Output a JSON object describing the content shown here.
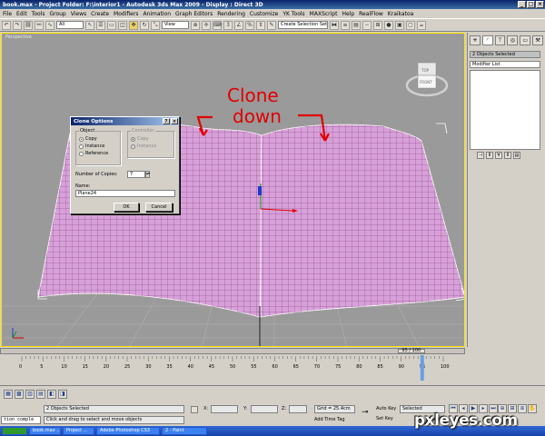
{
  "window": {
    "title": "book.max   - Project Folder: F:\\interior1      - Autodesk 3ds Max  2009        - Display : Direct 3D"
  },
  "menu": [
    "File",
    "Edit",
    "Tools",
    "Group",
    "Views",
    "Create",
    "Modifiers",
    "Animation",
    "Graph Editors",
    "Rendering",
    "Customize",
    "YK Tools",
    "MAXScript",
    "Help",
    "RealFlow",
    "Kraikatoa"
  ],
  "toolbar": {
    "filter": "All",
    "coord": "View",
    "selection_set": "Create Selection Set"
  },
  "viewport": {
    "label": "Perspective",
    "viewcube_top": "TOP",
    "viewcube_front": "FRONT",
    "annotation_line1": "Clone",
    "annotation_line2": "down"
  },
  "right_panel": {
    "name": "2 Objects Selected",
    "modifier_list": "Modifier List"
  },
  "dialog": {
    "title": "Clone Options",
    "object_group": "Object",
    "object_options": [
      "Copy",
      "Instance",
      "Reference"
    ],
    "controller_group": "Controller",
    "controller_options": [
      "Copy",
      "Instance"
    ],
    "copies_label": "Number of Copies:",
    "copies_value": "7",
    "name_label": "Name:",
    "name_value": "Plane24",
    "ok": "OK",
    "cancel": "Cancel"
  },
  "timeline": {
    "frame": "95 / 100",
    "ticks": [
      "0",
      "5",
      "10",
      "15",
      "20",
      "25",
      "30",
      "35",
      "40",
      "45",
      "50",
      "55",
      "60",
      "65",
      "70",
      "75",
      "80",
      "85",
      "90",
      "95",
      "100"
    ],
    "position": 0.95
  },
  "status": {
    "maxscript": "tion comple",
    "selection": "2 Objects Selected",
    "prompt": "Click and drag to select and move objects",
    "x_label": "X:",
    "y_label": "Y:",
    "z_label": "Z:",
    "grid": "Grid = 25.4cm",
    "add_time_tag": "Add Time Tag",
    "auto_key": "Auto Key",
    "set_key": "Set Key",
    "key_mode": "Selected",
    "key_filters": "Key Filters..."
  },
  "taskbar": [
    "book.max ...",
    "Project ...",
    "Adobe Photoshop CS3",
    "2 - Paint"
  ],
  "watermark": "pxleyes.com",
  "colors": {
    "annotation": "#e00000",
    "mesh": "#d8a0d8"
  }
}
